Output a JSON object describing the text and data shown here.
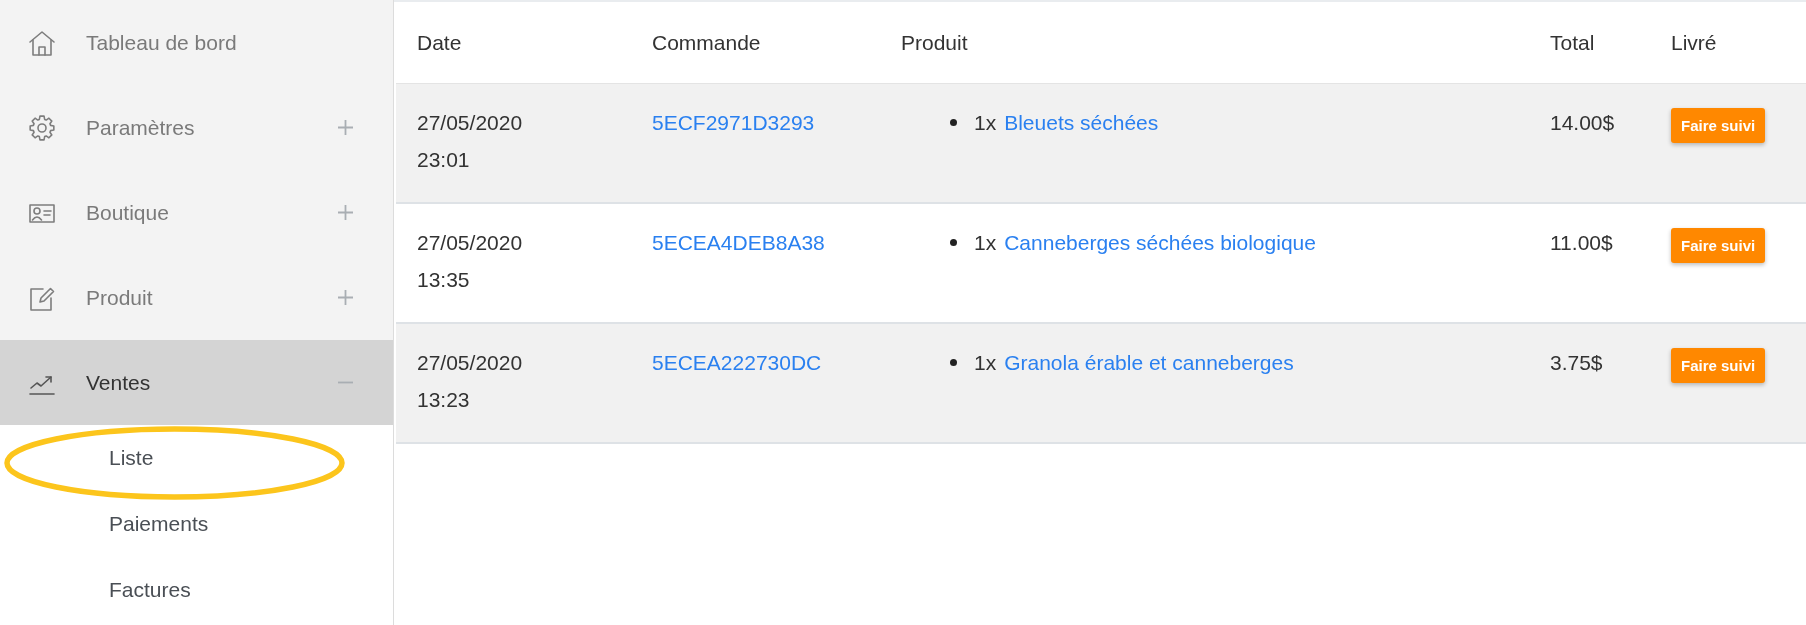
{
  "sidebar": {
    "items": [
      {
        "kind": "dashboard",
        "label": "Tableau de bord"
      },
      {
        "kind": "settings",
        "label": "Paramètres",
        "expanded": false
      },
      {
        "kind": "shop",
        "label": "Boutique",
        "expanded": false
      },
      {
        "kind": "product",
        "label": "Produit",
        "expanded": false
      },
      {
        "kind": "sales",
        "label": "Ventes",
        "expanded": true,
        "children": [
          {
            "label": "Liste",
            "circled": true
          },
          {
            "label": "Paiements",
            "circled": false
          },
          {
            "label": "Factures",
            "circled": false
          }
        ]
      }
    ]
  },
  "table": {
    "columns": [
      "Date",
      "Commande",
      "Produit",
      "Total",
      "Livré"
    ],
    "rows": [
      {
        "date": "27/05/2020 23:01",
        "order": "5ECF2971D3293",
        "items": [
          {
            "quantity": "1x",
            "product": "Bleuets séchées"
          }
        ],
        "total": "14.00$",
        "action": "Faire suivi"
      },
      {
        "date": "27/05/2020 13:35",
        "order": "5ECEA4DEB8A38",
        "items": [
          {
            "quantity": "1x",
            "product": "Canneberges séchées biologique"
          }
        ],
        "total": "11.00$",
        "action": "Faire suivi"
      },
      {
        "date": "27/05/2020 13:23",
        "order": "5ECEA222730DC",
        "items": [
          {
            "quantity": "1x",
            "product": "Granola érable et canneberges"
          }
        ],
        "total": "3.75$",
        "action": "Faire suivi"
      }
    ]
  }
}
